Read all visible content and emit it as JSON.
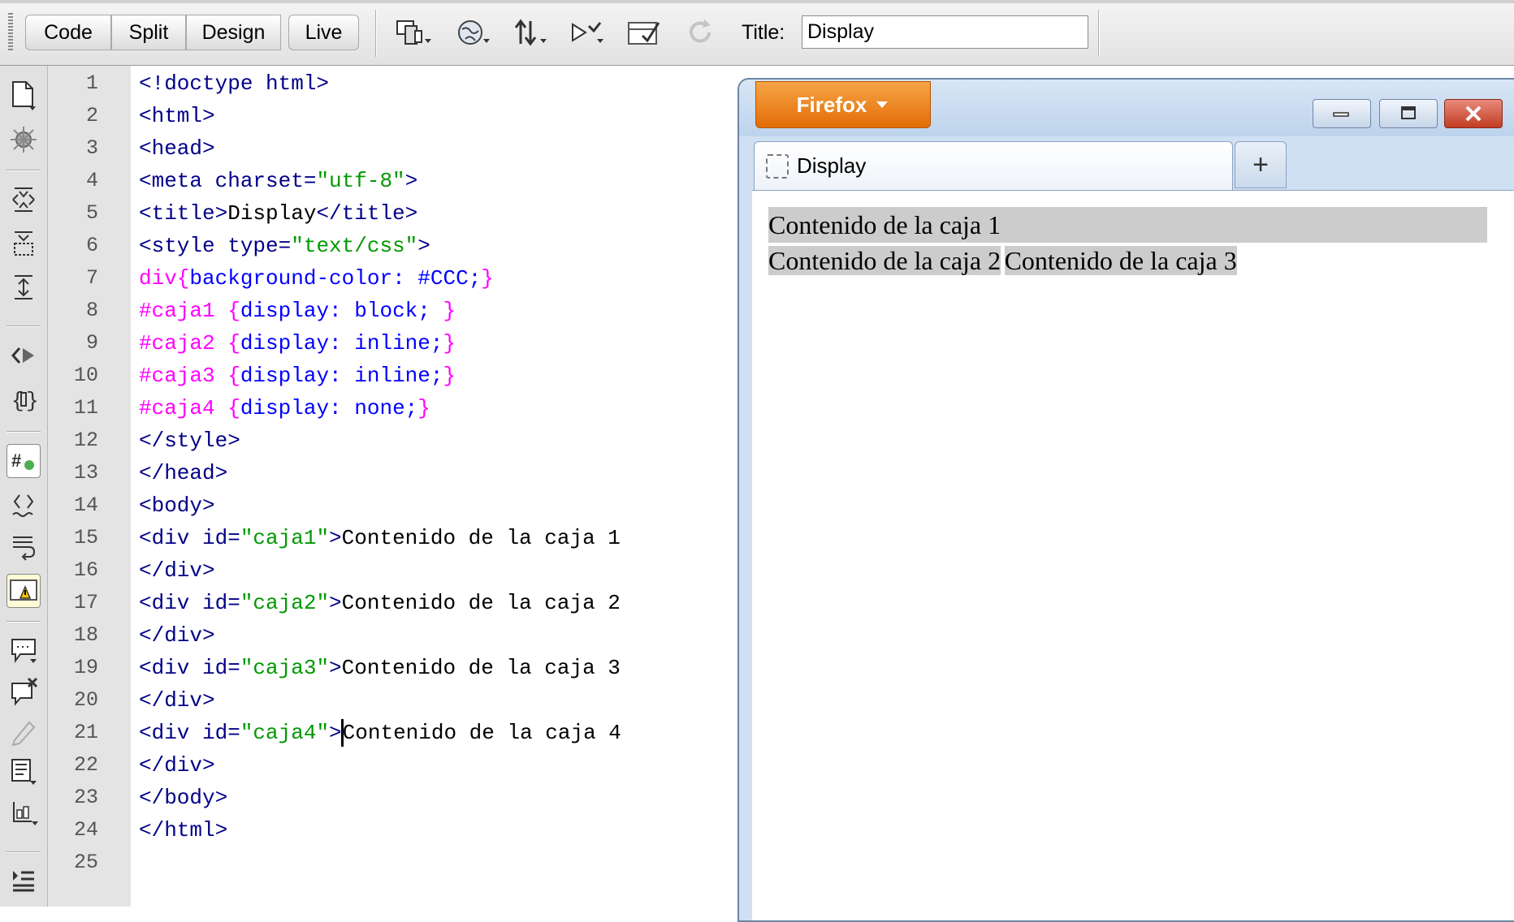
{
  "toolbar": {
    "view_buttons": [
      "Code",
      "Split",
      "Design",
      "Live"
    ],
    "title_label": "Title:",
    "title_value": "Display",
    "icons": [
      "multiscreen-icon",
      "preview-globe-icon",
      "file-transfer-icon",
      "debug-icon",
      "validate-icon",
      "refresh-icon"
    ]
  },
  "tools": [
    "open-documents-icon",
    "snippets-icon",
    "collapse-tag-icon",
    "collapse-selection-icon",
    "expand-all-icon",
    "select-parent-tag-icon",
    "balance-braces-icon",
    "line-numbers-icon",
    "highlight-invalid-code-icon",
    "word-wrap-icon",
    "syntax-error-alerts-icon",
    "apply-comment-icon",
    "remove-comment-icon",
    "wrap-tag-icon",
    "recent-snippets-icon",
    "move-css-icon",
    "indent-code-icon"
  ],
  "code": {
    "line_numbers": [
      "1",
      "2",
      "3",
      "4",
      "5",
      "6",
      "7",
      "8",
      "9",
      "10",
      "11",
      "12",
      "13",
      "14",
      "15",
      "16",
      "17",
      "18",
      "19",
      "20",
      "21",
      "22",
      "23",
      "24",
      "25"
    ],
    "lines": [
      "<!doctype html>",
      "<html>",
      "<head>",
      "<meta charset=\"utf-8\">",
      "<title>Display</title>",
      "<style type=\"text/css\">",
      "div{background-color: #CCC;}",
      "#caja1 {display: block; }",
      "#caja2 {display: inline;}",
      "#caja3 {display: inline;}",
      "#caja4 {display: none;}",
      "</style>",
      "</head>",
      "<body>",
      "<div id=\"caja1\">Contenido de la caja 1",
      "</div>",
      "<div id=\"caja2\">Contenido de la caja 2",
      "</div>",
      "<div id=\"caja3\">Contenido de la caja 3",
      "</div>",
      "<div id=\"caja4\">Contenido de la caja 4",
      "</div>",
      "</body>",
      "</html>",
      ""
    ]
  },
  "browser": {
    "app_button": "Firefox",
    "tab_title": "Display",
    "new_tab": "+",
    "content": {
      "caja1": "Contenido de la caja 1",
      "caja2": "Contenido de la caja 2",
      "caja3": "Contenido de la caja 3"
    },
    "box_color": "#CCCCCC"
  }
}
